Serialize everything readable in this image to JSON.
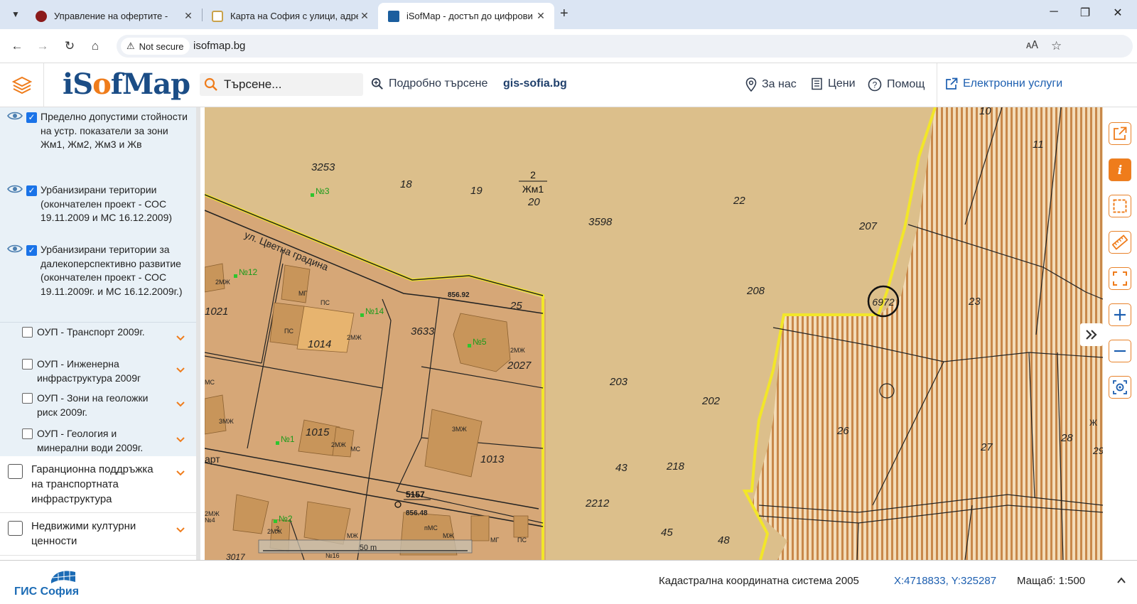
{
  "browser": {
    "tabs": [
      {
        "title": "Управление на офертите -",
        "color": "#8b1a1a"
      },
      {
        "title": "Карта на София с улици, адре",
        "color": "#c9a24b"
      },
      {
        "title": "iSofMap - достъп до цифрови",
        "color": "#1b5e9e"
      }
    ],
    "not_secure": "Not secure",
    "url": "isofmap.bg"
  },
  "header": {
    "logo_prefix": "iS",
    "logo_o": "o",
    "logo_suffix": "fMap",
    "search_placeholder": "Търсене...",
    "advanced_search": "Подробно търсене",
    "gis_link": "gis-sofia.bg",
    "about": "За нас",
    "prices": "Цени",
    "help": "Помощ",
    "eservices": "Електронни услуги"
  },
  "sidebar": {
    "checked_layers": [
      "Пределно допустими стойности на устр. показатели за зони Жм1, Жм2, Жм3 и Жв",
      "Урбанизирани територии (окончателен проект - СОС 19.11.2009 и МС 16.12.2009)",
      "Урбанизирани територии за далекоперспективно развитие (окончателен проект - СОС 19.11.2009г. и МС 16.12.2009г.)"
    ],
    "sub_layers": [
      "ОУП - Транспорт 2009г.",
      "ОУП - Инженерна инфраструктура 2009г",
      "ОУП - Зони на геоложки риск 2009г.",
      "ОУП - Геология и минерални води 2009г."
    ],
    "top_layers": [
      "Гаранционна поддръжка на транспортната инфраструктура",
      "Недвижими културни ценности"
    ]
  },
  "map": {
    "street": "ул. Цветна градина",
    "street2": "арт",
    "zone_num": "2",
    "zone_name": "Жм1",
    "scale_label": "50 m",
    "parcels": [
      "3253",
      "18",
      "19",
      "20",
      "22",
      "3598",
      "207",
      "208",
      "23",
      "6972",
      "1021",
      "1014",
      "3633",
      "25",
      "2027",
      "203",
      "202",
      "26",
      "1015",
      "1013",
      "43",
      "218",
      "27",
      "28",
      "2212",
      "45",
      "48",
      "5157",
      "10",
      "11"
    ],
    "points": [
      "№3",
      "№12",
      "№14",
      "№5",
      "№1",
      "№2"
    ],
    "elevation1": "856.92",
    "elevation2": "856.48",
    "building_labels": [
      "2МЖ",
      "МГ",
      "ПС",
      "ПС",
      "2МЖ",
      "2МЖ",
      "3МЖ",
      "МС",
      "3МЖ",
      "2МЖ",
      "МС",
      "2МЖ",
      "2МЖ",
      "пМС",
      "МЖ",
      "МГ",
      "ПС",
      "Ж",
      "№4",
      "№16",
      "МЖ",
      "2",
      "3017",
      "29"
    ]
  },
  "footer": {
    "logo_text": "ГИС София",
    "crs": "Кадастрална координатна система 2005",
    "coords": "X:4718833, Y:325287",
    "scale": "Мащаб: 1:500"
  }
}
